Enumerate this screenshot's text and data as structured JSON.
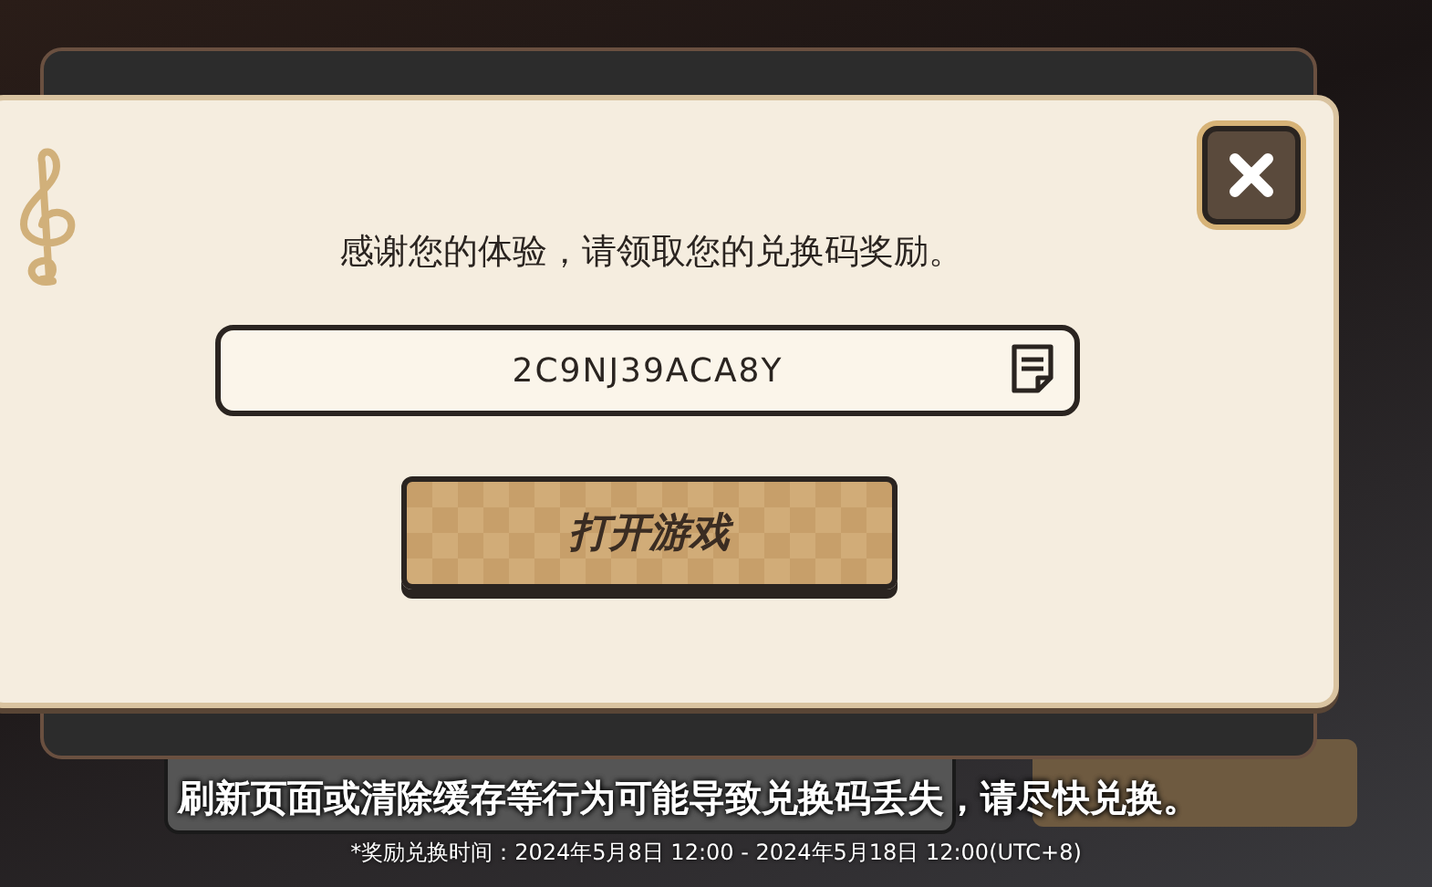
{
  "dialog": {
    "message": "感谢您的体验，请领取您的兑换码奖励。",
    "code_field": {
      "value": "2C9NJ39ACA8Y"
    },
    "open_game_button": {
      "label": "打开游戏"
    }
  },
  "notice": {
    "warning": "刷新页面或清除缓存等行为可能导致兑换码丢失，请尽快兑换。",
    "reward_time": "*奖励兑换时间：2024年5月8日 12:00 - 2024年5月18日 12:00(UTC+8)"
  }
}
